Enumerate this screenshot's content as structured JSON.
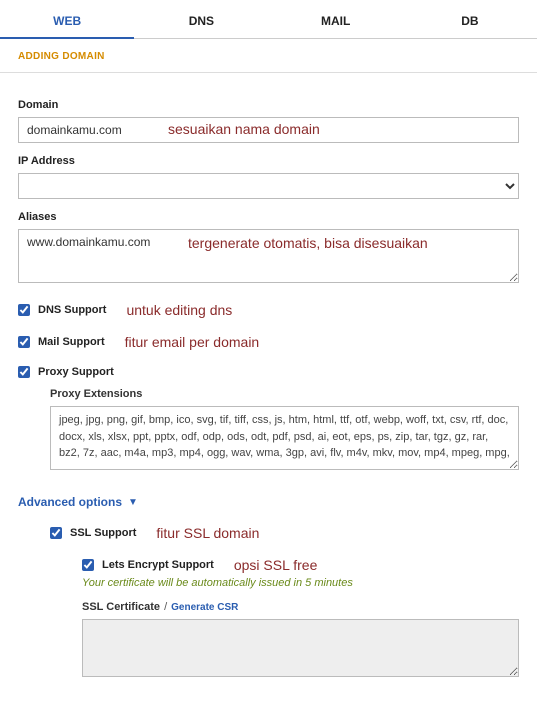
{
  "tabs": {
    "web": "WEB",
    "dns": "DNS",
    "mail": "MAIL",
    "db": "DB"
  },
  "subheader": "ADDING DOMAIN",
  "labels": {
    "domain": "Domain",
    "ip": "IP Address",
    "aliases": "Aliases",
    "proxy_ext": "Proxy Extensions",
    "ssl_cert": "SSL Certificate"
  },
  "values": {
    "domain": "domainkamu.com",
    "aliases": "www.domainkamu.com",
    "proxy_ext": "jpeg, jpg, png, gif, bmp, ico, svg, tif, tiff, css, js, htm, html, ttf, otf, webp, woff, txt, csv, rtf, doc, docx, xls, xlsx, ppt, pptx, odf, odp, ods, odt, pdf, psd, ai, eot, eps, ps, zip, tar, tgz, gz, rar, bz2, 7z, aac, m4a, mp3, mp4, ogg, wav, wma, 3gp, avi, flv, m4v, mkv, mov, mp4, mpeg, mpg,",
    "ssl_cert": ""
  },
  "checks": {
    "dns": "DNS Support",
    "mail": "Mail Support",
    "proxy": "Proxy Support",
    "ssl": "SSL Support",
    "le": "Lets Encrypt Support"
  },
  "adv": {
    "label": "Advanced options"
  },
  "le_note": "Your certificate will be automatically issued in 5 minutes",
  "gen_csr": "Generate CSR",
  "slash": "/",
  "annotations": {
    "domain": "sesuaikan nama domain",
    "aliases": "tergenerate otomatis, bisa disesuaikan",
    "dns": "untuk editing dns",
    "mail": "fitur email per domain",
    "ssl": "fitur SSL domain",
    "le": "opsi SSL free"
  }
}
